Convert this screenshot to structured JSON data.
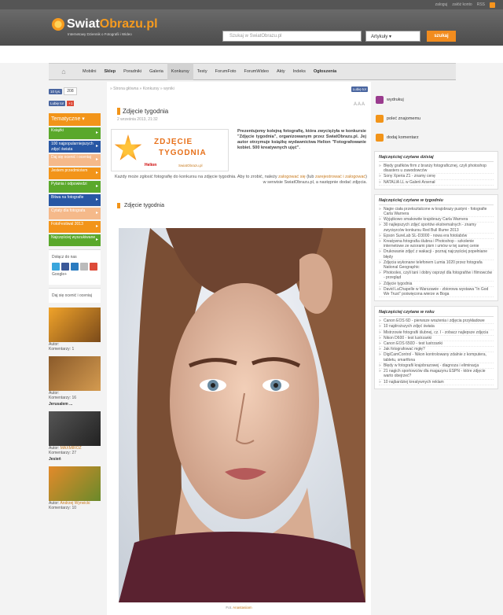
{
  "topbar": {
    "login": "zaloguj",
    "register": "załóż konto",
    "rss": "RSS"
  },
  "header": {
    "logo_main": "Swiat",
    "logo_accent": "Obrazu.pl",
    "tagline": "Internetowy Dziennik o Fotografii i Wideo",
    "search_placeholder": "Szukaj w SwiatObrazu.pl",
    "search_select": "Artykuły",
    "search_button": "szukaj"
  },
  "nav": {
    "home": "⌂",
    "items": [
      {
        "label": "Mobilni",
        "bold": false
      },
      {
        "label": "Sklep",
        "bold": true
      },
      {
        "label": "Poradniki",
        "bold": false
      },
      {
        "label": "Galeria",
        "bold": false
      },
      {
        "label": "Konkursy",
        "bold": false,
        "active": true
      },
      {
        "label": "Testy",
        "bold": false
      },
      {
        "label": "ForumFoto",
        "bold": false
      },
      {
        "label": "ForumWideo",
        "bold": false
      },
      {
        "label": "Akty",
        "bold": false
      },
      {
        "label": "Indeks",
        "bold": false
      },
      {
        "label": "Ogłoszenia",
        "bold": true
      }
    ]
  },
  "left": {
    "fb_likes": "10 tys.",
    "count": "208",
    "fb_like": "Lubię to!",
    "gplus": "+1",
    "thematic": "Tematyczne",
    "menu": [
      {
        "label": "Książki",
        "color": "#5aa82b"
      },
      {
        "label": "100 najpopularniejszych zdjęć świata",
        "color": "#2857a4"
      },
      {
        "label": "Daj się ocenić i oceniaj",
        "color": "#f5b98a"
      },
      {
        "label": "Jestem przedmiotem",
        "color": "#f29419"
      },
      {
        "label": "Pytania i odpowiedzi",
        "color": "#5aa82b"
      },
      {
        "label": "Bitwa na fotografie",
        "color": "#2857a4"
      },
      {
        "label": "Cytaty dla fotografa",
        "color": "#f5b98a"
      },
      {
        "label": "FotoFestiwal 2013",
        "color": "#f29419"
      },
      {
        "label": "Najczęściej wyszukiwane",
        "color": "#5aa82b"
      }
    ],
    "follow": "Dołącz do nas",
    "gplus_label": "Google+",
    "rate_box": "Daj się ocenić i oceniaj",
    "thumbs": [
      {
        "title": "",
        "author": "Autor: ",
        "author_link": "",
        "comments": "Komentarzy: 1",
        "colors": [
          "#f0a32a",
          "#7a4a1a"
        ]
      },
      {
        "title": "",
        "author": "Autor: ",
        "author_link": "",
        "comments": "Komentarzy: 16",
        "colors": [
          "#8a5a2a",
          "#d49b50"
        ]
      },
      {
        "title": "Jerusalem ...",
        "author": "Autor: ",
        "author_link": "MAXMIROZ",
        "comments": "Komentarzy: 27",
        "colors": [
          "#555",
          "#222"
        ]
      },
      {
        "title": "Jesień",
        "author": "Autor: ",
        "author_link": "Andrzej Wyrwicki",
        "comments": "Komentarzy: 10",
        "colors": [
          "#e38a2a",
          "#6a8a2a"
        ]
      }
    ]
  },
  "main": {
    "crumbs": "» Strona główna » Konkursy » wyniki",
    "crumb_share": "Lubię to!",
    "title": "Zdjęcie tygodnia",
    "date": "2 września 2013, 21:32",
    "font_sizes": "A A A",
    "banner_line1": "ZDJĘCIE",
    "banner_line2": "TYGODNIA",
    "banner_helion": "Helion",
    "banner_site": "SwiatObrazu.pl",
    "lead": "Prezentujemy kolejną fotografię, która zwyciężyła w konkursie \"Zdjęcie tygodnia\", organizowanym przez SwiatObrazu.pl. Jej autor otrzymuje książkę wydawnictwa Helion \"Fotografowanie kobiet. 500 kreatywnych ujęć\".",
    "body_1": "Każdy może zgłosić fotografię do konkursu na zdjęcie tygodnia. Aby to zrobić, należy ",
    "body_link1": "zalogować się",
    "body_2": " (lub ",
    "body_link2": "zarejestrować i zalogować",
    "body_3": ") w serwisie SwiatObrazu.pl, a następnie dodać zdjęcia.",
    "subtitle": "Zdjęcie tygodnia",
    "caption_prefix": "Fot. ",
    "caption_author": "Anastasiiam"
  },
  "right": {
    "tools": [
      {
        "label": "wydrukuj",
        "color": "#9a3b8e"
      },
      {
        "label": "poleć znajomemu",
        "color": "#f29419"
      },
      {
        "label": "dodaj komentarz",
        "color": "#f29419"
      }
    ],
    "today": {
      "title": "Najczęściej czytane dzisiaj",
      "items": [
        "Błędy grafików firm z branży fotograficznej, czyli photoshop disasters u zawodowców",
        "Sony Xperia Z1 - znamy cenę",
        "NATALIA LL w Galerii Arsenał"
      ]
    },
    "week": {
      "title": "Najczęściej czytane w tygodniu",
      "items": [
        "Nagie ciała przeksztalcone w krajobrazy pustyni - fotografie Carla Warnera",
        "Wyjątkowo smakowite krajobrazy Carla Warnera",
        "30 najlepszych zdjęć sportów ekstremalnych - znamy zwycięzców konkursu Red Bull Illume 2013",
        "Epson SureLab SL-D3000 - nowa era fotolabów",
        "Kreatywna fotografia ślubna i Photoshop - szkolenie internetowe ze wzorami pism i umów w tej samej cenie",
        "Drukowanie zdjęć z wakacji - poznaj najczęściej popełniane błędy",
        "Zdjęcia wykonane telefonem Lumia 1020 przez fotografa National Geographic",
        "Photoolex, czyli tani i dobry osprzęt dla fotografów i filmowców - przegląd",
        "Zdjęcie tygodnia",
        "David LaChapelle w Warszawie - zbiorowa wystawa \"In God We Trust\" poświęcona wierze w Boga"
      ]
    },
    "year": {
      "title": "Najczęściej czytane w roku",
      "items": [
        "Canon EOS 6D - pierwsze wrażenia i zdjęcia przykładowe",
        "10 najdroższych zdjęć świata",
        "Mistrzowie fotografii ślubnej, cz. I - zobacz najlepsze zdjęcia",
        "Nikon D600 - test lustrzanki",
        "Canon EOS 650D - test lustrzanki",
        "Jak fotografować mgłę?",
        "DigiCamControl - Nikon kontrolowany zdalnie z komputera, tabletu, smartfona",
        "Błędy w fotografii krajobrazowej - diagnoza i eliminacja",
        "21 nagich sportowców dla magazynu ESPN - które zdjęcie warto obejrzeć?",
        "10 najbardziej kreatywnych reklam"
      ]
    }
  }
}
